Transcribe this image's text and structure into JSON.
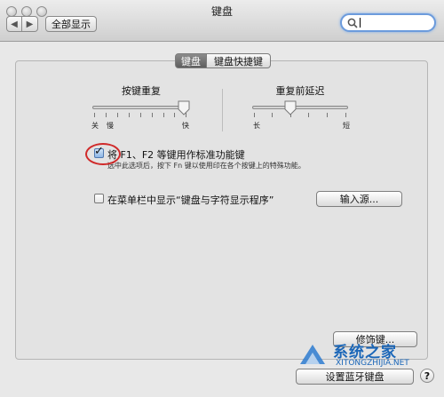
{
  "window": {
    "title": "键盘"
  },
  "toolbar": {
    "show_all_label": "全部显示",
    "back_glyph": "◀",
    "forward_glyph": "▶"
  },
  "search": {
    "value": ""
  },
  "tabs": [
    {
      "label": "键盘",
      "selected": true
    },
    {
      "label": "键盘快捷键",
      "selected": false
    }
  ],
  "key_repeat": {
    "title": "按键重复",
    "min_label": "关",
    "slow_label": "慢",
    "max_label": "快",
    "level": 0.95
  },
  "delay_until_repeat": {
    "title": "重复前延迟",
    "min_label": "长",
    "max_label": "短",
    "level": 0.4
  },
  "fkeys": {
    "label": "将 F1、F2 等键用作标准功能键",
    "hint": "选中此选项后，按下 Fn 键以使用印在各个按键上的特殊功能。",
    "checked": true
  },
  "menubar": {
    "label": "在菜单栏中显示“键盘与字符显示程序”",
    "checked": false
  },
  "buttons": {
    "input_sources": "输入源...",
    "modifier_keys": "修饰键...",
    "bluetooth_keyboard": "设置蓝牙键盘",
    "help": "?"
  },
  "watermark": {
    "name": "系统之家",
    "url": "XITONGZHIJIA.NET"
  },
  "colors": {
    "search_focus": "#6c9bdc",
    "annotation_circle": "#d02a2a",
    "watermark": "#1a66b8"
  }
}
